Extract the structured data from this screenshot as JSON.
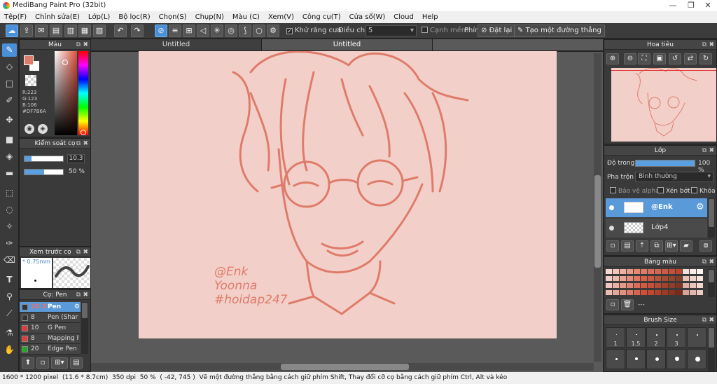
{
  "window": {
    "title": "MediBang Paint Pro (32bit)"
  },
  "menu": [
    "Tệp(F)",
    "Chỉnh sửa(E)",
    "Lớp(L)",
    "Bộ lọc(R)",
    "Chọn(S)",
    "Chụp(N)",
    "Màu (C)",
    "Xem(V)",
    "Công cụ(T)",
    "Cửa sổ(W)",
    "Cloud",
    "Help"
  ],
  "toolbar": {
    "antialias_label": "Khử răng cưa",
    "adjust_label": "Điều chỉnh",
    "adjust_value": "5",
    "edge_label": "Cạnh mềm",
    "key_label": "Phím",
    "reset_label": "Đặt lại",
    "straight_label": "Tạo một đường thẳng"
  },
  "color_panel": {
    "title": "Màu",
    "primary_color": "#DF7B6A",
    "r": "R:223",
    "g": "G:123",
    "b": "B:106",
    "hex": "#DF7B6A"
  },
  "brush_control": {
    "title": "Kiểm soát cọ",
    "size": "10.3",
    "opacity": "50 %"
  },
  "brush_preview": {
    "title": "Xem trước cọ",
    "size": "0.75mm"
  },
  "brush_list": {
    "title": "Cọ: Pen",
    "items": [
      {
        "size": "10.3",
        "name": "Pen",
        "color": "#333333"
      },
      {
        "size": "8",
        "name": "Pen (Sharp)",
        "color": "#333333"
      },
      {
        "size": "10",
        "name": "G Pen",
        "color": "#e03a3a"
      },
      {
        "size": "8",
        "name": "Mapping Pen",
        "color": "#e03a3a"
      },
      {
        "size": "20",
        "name": "Edge Pen",
        "color": "#22aa22"
      }
    ]
  },
  "tabs": [
    "Untitled",
    "Untitled"
  ],
  "canvas": {
    "line_color": "#DF7B6A",
    "sig1": "@Enk",
    "sig2": "Yoonna",
    "sig3": "#hoidap247"
  },
  "navigator": {
    "title": "Hoa tiêu"
  },
  "layer_panel": {
    "title": "Lớp",
    "opacity_label": "Độ trong",
    "opacity_value": "100 %",
    "opacity_fraction": 1.0,
    "blend_label": "Pha trộn",
    "blend_value": "Bình thường",
    "protect_alpha": "Bảo vệ alpha",
    "clipping": "Xén bớt",
    "lock": "Khóa",
    "layers": [
      {
        "name": "@Enk",
        "selected": true
      },
      {
        "name": "Lớp4",
        "selected": false
      }
    ]
  },
  "palette": {
    "title": "Bảng màu",
    "name": "---"
  },
  "brush_size": {
    "title": "Brush Size",
    "labels": [
      "1",
      "1.5",
      "2",
      "3"
    ]
  },
  "status": {
    "dimensions": "1600 * 1200 pixel",
    "physical": "(11.6 * 8.7cm)",
    "dpi": "350 dpi",
    "zoom": "50 %",
    "coords": "( -42, 745 )",
    "hint": "Vẽ một đường thẳng bằng cách giữ phím Shift, Thay đổi cỡ cọ bằng cách giữ phím Ctrl, Alt và kéo"
  }
}
